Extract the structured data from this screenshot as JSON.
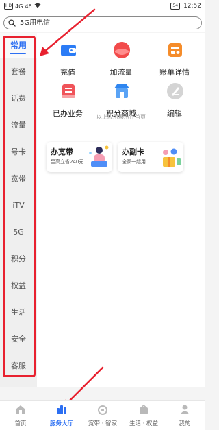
{
  "status_bar": {
    "left_indicators": [
      "HD",
      "4G",
      "46"
    ],
    "time": "12:52",
    "battery": "54"
  },
  "search": {
    "value": "5G用电信",
    "icon": "search-icon"
  },
  "sidebar": {
    "items": [
      {
        "label": "常用",
        "active": true
      },
      {
        "label": "套餐",
        "active": false
      },
      {
        "label": "话费",
        "active": false
      },
      {
        "label": "流量",
        "active": false
      },
      {
        "label": "号卡",
        "active": false
      },
      {
        "label": "宽带",
        "active": false
      },
      {
        "label": "iTV",
        "active": false
      },
      {
        "label": "5G",
        "active": false
      },
      {
        "label": "积分",
        "active": false
      },
      {
        "label": "权益",
        "active": false
      },
      {
        "label": "生活",
        "active": false
      },
      {
        "label": "安全",
        "active": false
      },
      {
        "label": "客服",
        "active": false
      }
    ]
  },
  "apps": [
    {
      "label": "充值",
      "icon": "wallet-icon",
      "color": "#2b7cf6"
    },
    {
      "label": "加流量",
      "icon": "data-plus-icon",
      "color": "#f24b4b"
    },
    {
      "label": "账单详情",
      "icon": "bill-icon",
      "color": "#f58c2a"
    },
    {
      "label": "已办业务",
      "icon": "handled-services-icon",
      "color": "#f0545a"
    },
    {
      "label": "积分商城",
      "icon": "shop-icon",
      "color": "#2f86f0"
    },
    {
      "label": "编辑",
      "icon": "edit-icon",
      "color": "#c8c8c8"
    }
  ],
  "hint": "以上应用展示在首页",
  "promos": [
    {
      "title": "办宽带",
      "subtitle": "至高立省240元"
    },
    {
      "title": "办副卡",
      "subtitle": "全家一起用"
    }
  ],
  "tabbar": {
    "items": [
      {
        "label": "首页",
        "icon": "home-icon",
        "active": false
      },
      {
        "label": "服务大厅",
        "icon": "service-hall-icon",
        "active": true
      },
      {
        "label": "宽带 · 智家",
        "icon": "broadband-icon",
        "active": false
      },
      {
        "label": "生活 · 权益",
        "icon": "life-icon",
        "active": false
      },
      {
        "label": "我的",
        "icon": "profile-icon",
        "active": false
      }
    ]
  },
  "colors": {
    "accent": "#2c6ff2",
    "annotation": "#e8212f"
  }
}
